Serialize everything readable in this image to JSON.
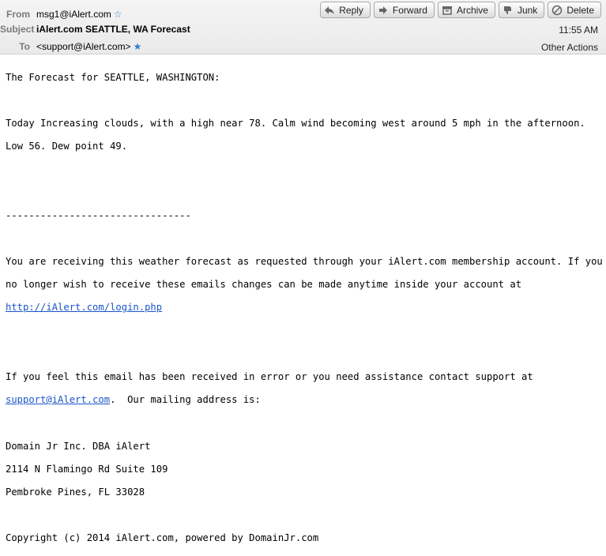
{
  "header": {
    "from_label": "From",
    "from_value": "msg1@iAlert.com",
    "subject_label": "Subject",
    "subject_value": "iAlert.com SEATTLE, WA Forecast",
    "to_label": "To",
    "to_value": "<support@iAlert.com>",
    "time": "11:55 AM",
    "other_actions": "Other Actions"
  },
  "toolbar": {
    "reply": "Reply",
    "forward": "Forward",
    "archive": "Archive",
    "junk": "Junk",
    "delete": "Delete"
  },
  "body": {
    "line1": "The Forecast for SEATTLE, WASHINGTON:",
    "line2": "Today Increasing clouds, with a high near 78. Calm wind becoming west around 5 mph in the afternoon.",
    "line3": "Low 56. Dew point 49.",
    "separator": "--------------------------------",
    "line4": "You are receiving this weather forecast as requested through your iAlert.com membership account. If you",
    "line5": "no longer wish to receive these emails changes can be made anytime inside your account at",
    "login_link": "http://iAlert.com/login.php",
    "line6": "If you feel this email has been received in error or you need assistance contact support at",
    "support_link": "support@iAlert.com",
    "line7_tail": ".  Our mailing address is:",
    "addr1": "Domain Jr Inc. DBA iAlert",
    "addr2": "2114 N Flamingo Rd Suite 109",
    "addr3": "Pembroke Pines, FL 33028",
    "copyright": "Copyright (c) 2014 iAlert.com, powered by DomainJr.com"
  }
}
